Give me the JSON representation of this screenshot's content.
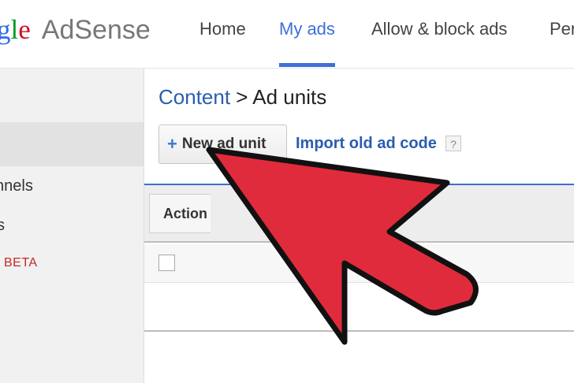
{
  "header": {
    "logo": {
      "g1": "g",
      "l": "l",
      "e": "e",
      "product": "AdSense"
    },
    "tabs": [
      {
        "label": "Home"
      },
      {
        "label": "My ads"
      },
      {
        "label": "Allow & block ads"
      },
      {
        "label": "Per"
      }
    ],
    "active_tab": "My ads"
  },
  "sidebar": {
    "items": [
      {
        "label": "nnels"
      },
      {
        "label": "s"
      },
      {
        "label": "BETA"
      }
    ]
  },
  "main": {
    "breadcrumb": {
      "link": "Content",
      "separator": " > ",
      "current": "Ad units"
    },
    "new_button_plus": "+",
    "new_button_label": "New ad unit",
    "import_link": "Import old ad code",
    "help_icon": "?",
    "table": {
      "action_label": "Action"
    }
  },
  "colors": {
    "accent": "#3f6fd8",
    "link": "#2a5db0",
    "arrow": "#e02b3c"
  },
  "icons": {
    "help": "help-icon",
    "annotation": "red-arrow-icon"
  }
}
